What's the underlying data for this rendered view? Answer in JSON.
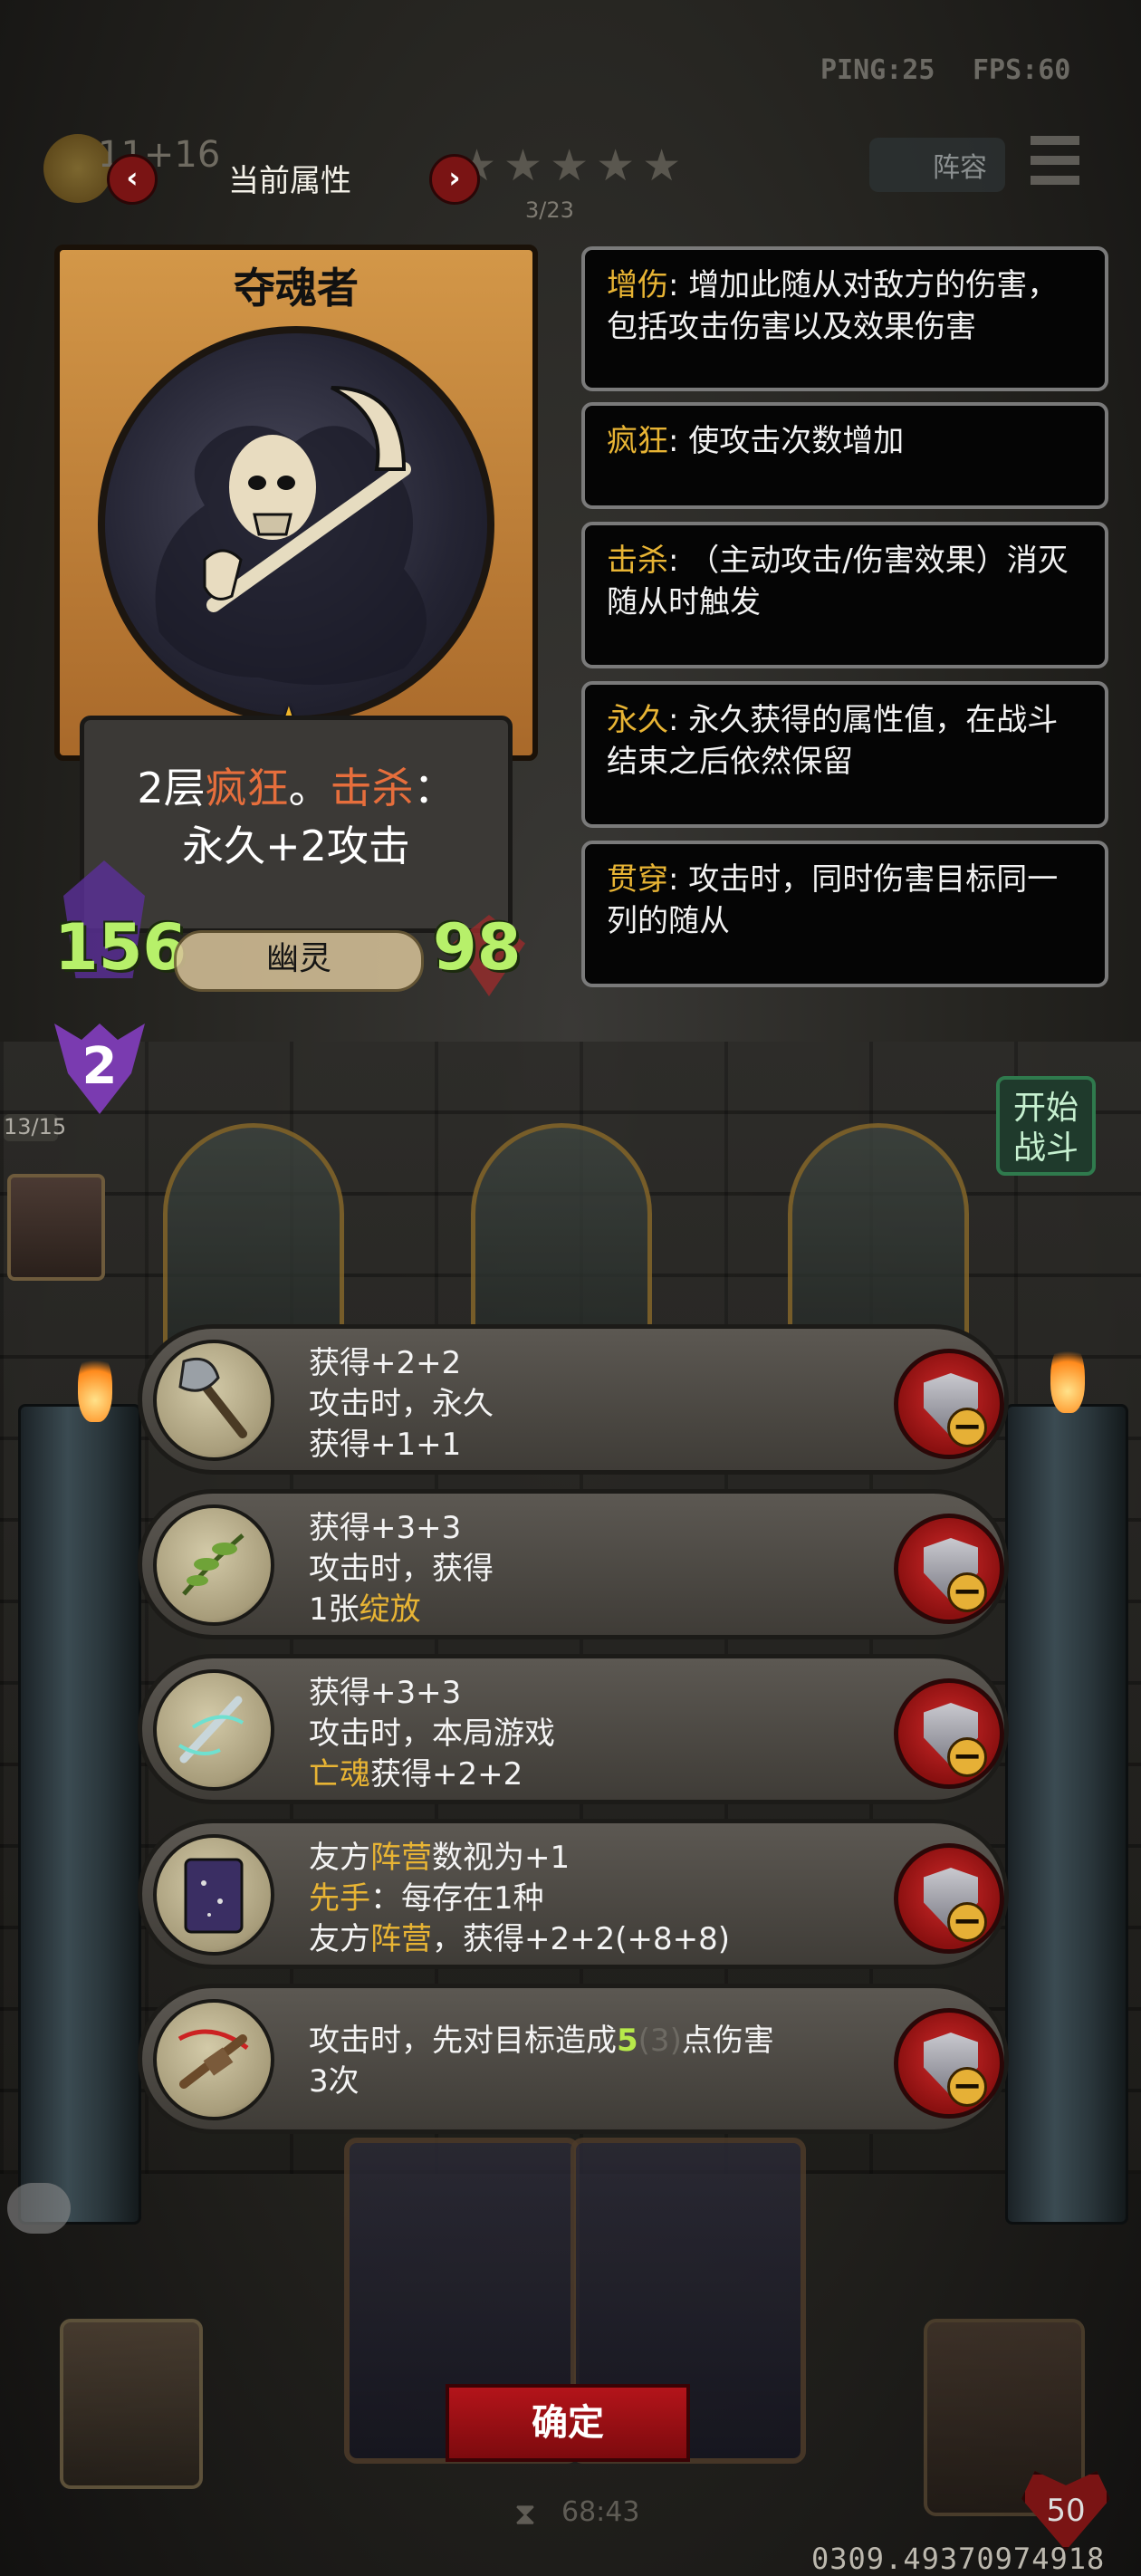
{
  "status": {
    "ping": "PING:25",
    "fps": "FPS:60"
  },
  "header": {
    "title": "当前属性",
    "prev": "‹",
    "next": "›",
    "page_indicator": "3/23",
    "stars": "★★★★★",
    "gold": "11+16",
    "lineup_label": "阵容"
  },
  "card": {
    "name": "夺魂者",
    "tier_star": "★",
    "desc_line1_a": "2层",
    "desc_line1_kw1": "疯狂",
    "desc_line1_b": "。",
    "desc_line1_kw2": "击杀",
    "desc_line1_c": "：",
    "desc_line2": "永久+2攻击",
    "attack": "156",
    "health": "98",
    "tribe": "幽灵"
  },
  "tier_badge": "2",
  "keywords": [
    {
      "name": "增伤",
      "text": ": 增加此随从对敌方的伤害，包括攻击伤害以及效果伤害"
    },
    {
      "name": "疯狂",
      "text": ": 使攻击次数增加"
    },
    {
      "name": "击杀",
      "text": ": （主动攻击/伤害效果）消灭随从时触发"
    },
    {
      "name": "永久",
      "text": ": 永久获得的属性值，在战斗结束之后依然保留"
    },
    {
      "name": "贯穿",
      "text": ": 攻击时，同时伤害目标同一列的随从"
    }
  ],
  "board": {
    "round_counter": "13/15",
    "start_battle": "开始战斗"
  },
  "buffs": [
    {
      "icon": "axe-icon",
      "lines": [
        "获得+2+2",
        "攻击时，永久",
        "获得+1+1"
      ]
    },
    {
      "icon": "herb-icon",
      "lines": [
        "获得+3+3",
        "攻击时，获得"
      ],
      "l3a": "1张",
      "l3b": "绽放"
    },
    {
      "icon": "ghost-sword-icon",
      "lines": [
        "获得+3+3",
        "攻击时，本局游戏"
      ],
      "l3a": "亡魂",
      "l3b": "获得+2+2"
    },
    {
      "icon": "spellbook-icon",
      "l1a": "友方",
      "l1b": "阵营",
      "l1c": "数视为+1",
      "l2a": "先手",
      "l2b": "：每存在1种",
      "l3a": "友方",
      "l3b": "阵营",
      "l3c": "，获得+2+2(+8+8)"
    },
    {
      "icon": "crossbow-icon",
      "l1a": "攻击时，先对目标造成",
      "l1b": "5",
      "l1c": "(3)",
      "l1d": "点伤害",
      "l2": "3次"
    }
  ],
  "bottom": {
    "confirm": "确定",
    "timer": "68:43",
    "serial": "0309.49370974918",
    "hero_hp": "50"
  }
}
